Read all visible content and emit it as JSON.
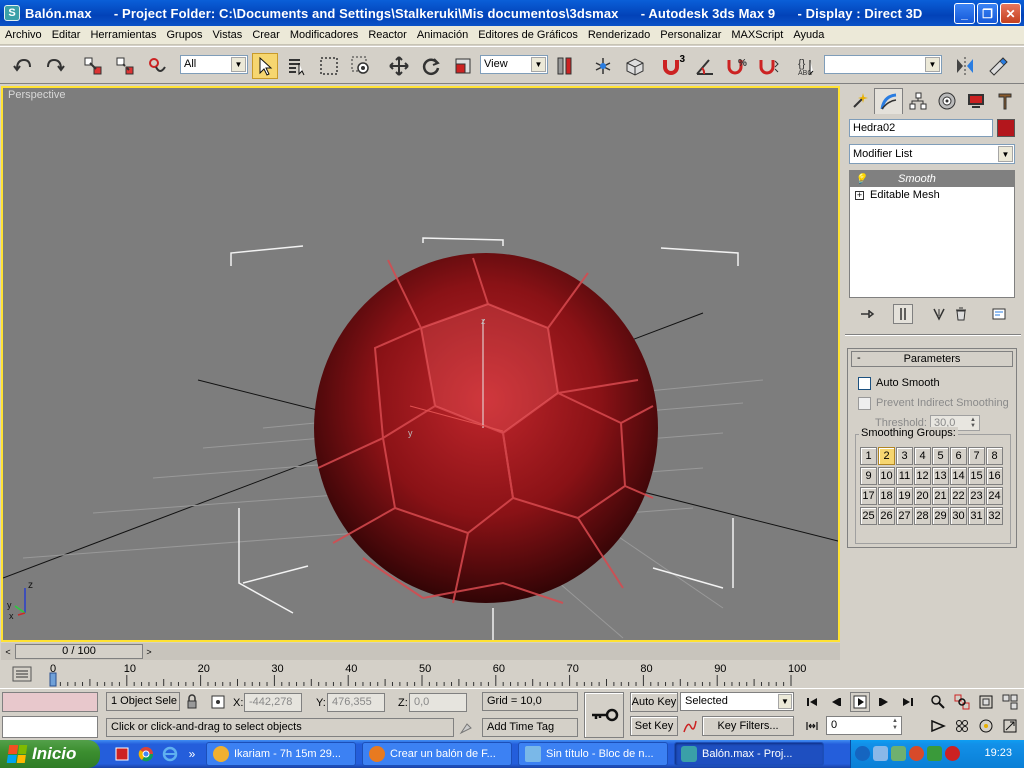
{
  "window": {
    "title": "Balón.max      - Project Folder: C:\\Documents and Settings\\Stalkeruki\\Mis documentos\\3dsmax      - Autodesk 3ds Max 9      - Display : Direct 3D"
  },
  "menu": [
    "Archivo",
    "Editar",
    "Herramientas",
    "Grupos",
    "Vistas",
    "Crear",
    "Modificadores",
    "Reactor",
    "Animación",
    "Editores de Gráficos",
    "Renderizado",
    "Personalizar",
    "MAXScript",
    "Ayuda"
  ],
  "toolbar": {
    "filter_value": "All",
    "refcoord_value": "View",
    "snap_value": "3",
    "selset_value": ""
  },
  "viewport": {
    "label": "Perspective",
    "axis_z": "z",
    "axis_y": "y",
    "axis_x": "x"
  },
  "panel": {
    "object_name": "Hedra02",
    "object_color": "#b3161c",
    "modifier_list": "Modifier List",
    "stack": [
      {
        "label": "Smooth",
        "selected": true
      },
      {
        "label": "Editable Mesh",
        "selected": false
      }
    ],
    "rollout_title": "Parameters",
    "rollout_toggle": "-",
    "auto_smooth": "Auto Smooth",
    "prevent_indirect": "Prevent Indirect Smoothing",
    "threshold_label": "Threshold:",
    "threshold_value": "30,0",
    "smoothing_groups_label": "Smoothing Groups:",
    "smoothing_groups": [
      "1",
      "2",
      "3",
      "4",
      "5",
      "6",
      "7",
      "8",
      "9",
      "10",
      "11",
      "12",
      "13",
      "14",
      "15",
      "16",
      "17",
      "18",
      "19",
      "20",
      "21",
      "22",
      "23",
      "24",
      "25",
      "26",
      "27",
      "28",
      "29",
      "30",
      "31",
      "32"
    ],
    "active_group": "2"
  },
  "timeline": {
    "frame_display": "0 / 100",
    "prev": "<",
    "next": ">",
    "ticks": [
      "0",
      "10",
      "20",
      "30",
      "40",
      "50",
      "60",
      "70",
      "80",
      "90",
      "100"
    ]
  },
  "status": {
    "selection": "1 Object Sele",
    "x_label": "X:",
    "x_value": "-442,278",
    "y_label": "Y:",
    "y_value": "476,355",
    "z_label": "Z:",
    "z_value": "0,0",
    "grid": "Grid = 10,0",
    "prompt": "Click or click-and-drag to select objects",
    "add_time_tag": "Add Time Tag",
    "auto_key": "Auto Key",
    "set_key": "Set Key",
    "key_mode": "Selected",
    "key_filters": "Key Filters...",
    "current_frame": "0"
  },
  "taskbar": {
    "start": "Inicio",
    "tasks": [
      {
        "label": "Ikariam - 7h 15m 29...",
        "color": "#f0b030"
      },
      {
        "label": "Crear un balón de F...",
        "color": "#e87a20"
      },
      {
        "label": "Sin título - Bloc de n...",
        "color": "#7ab8e8"
      },
      {
        "label": "Balón.max      - Proj...",
        "color": "#3aa0a8"
      }
    ],
    "quicklaunch_more": "»",
    "clock": "19:23"
  }
}
